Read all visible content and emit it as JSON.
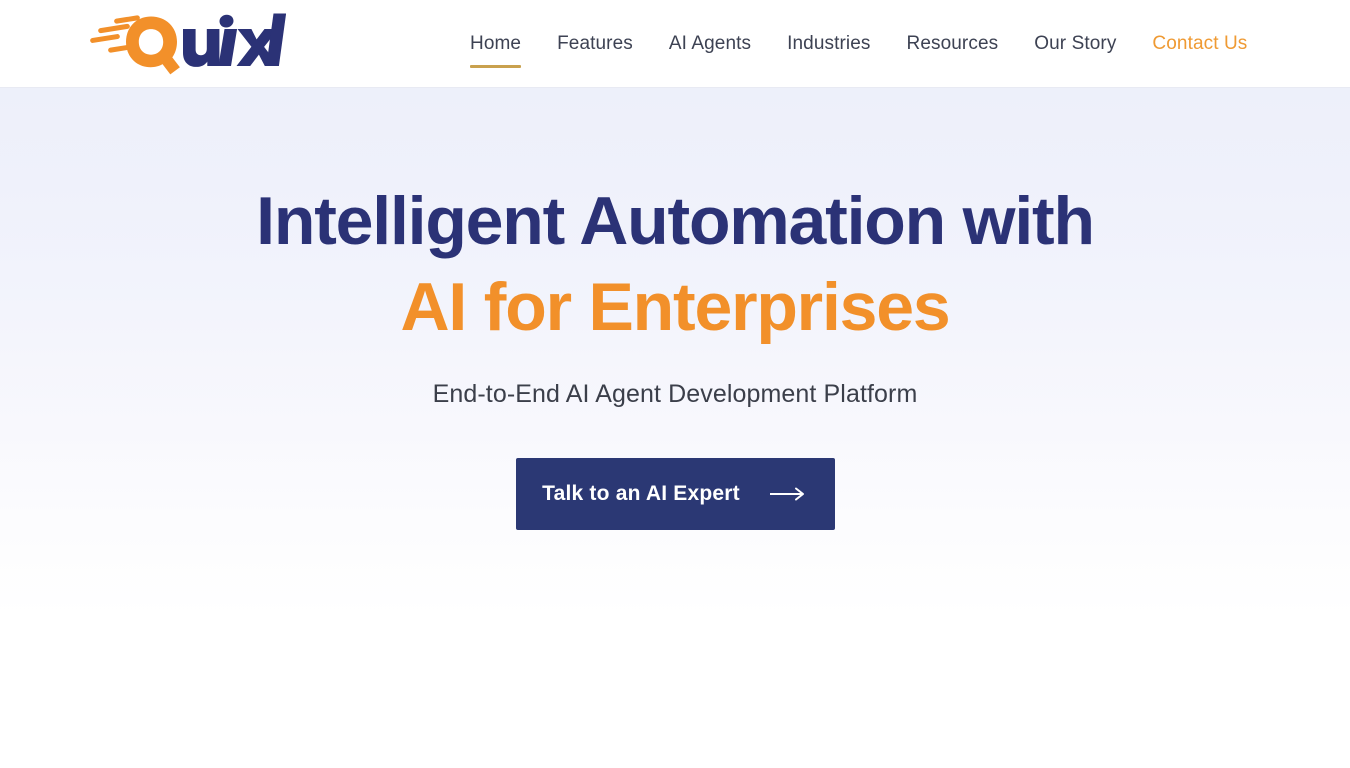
{
  "header": {
    "logo": {
      "name": "quixl-logo",
      "text": "Quixl",
      "mark_color": "#F2902A",
      "word_color": "#2B3276"
    },
    "nav": {
      "items": [
        {
          "label": "Home",
          "state": "active",
          "underline_color": "#C9A14E"
        },
        {
          "label": "Features",
          "state": "default",
          "underline_color": ""
        },
        {
          "label": "AI Agents",
          "state": "default",
          "underline_color": ""
        },
        {
          "label": "Industries",
          "state": "default",
          "underline_color": ""
        },
        {
          "label": "Resources",
          "state": "default",
          "underline_color": ""
        },
        {
          "label": "Our Story",
          "state": "default",
          "underline_color": ""
        },
        {
          "label": "Contact Us",
          "state": "accent",
          "underline_color": ""
        }
      ]
    }
  },
  "hero": {
    "title_line_1": "Intelligent Automation with",
    "title_line_2": "AI for Enterprises",
    "subtitle": "End-to-End AI Agent Development Platform",
    "cta": {
      "label": "Talk to an AI Expert",
      "icon": "arrow-right-icon",
      "background": "#2B3874",
      "text_color": "#FFFFFF"
    },
    "background_top": "#EDF0FA",
    "background_bottom": "#FFFFFF"
  },
  "colors": {
    "navy": "#2B3276",
    "orange": "#F2902A",
    "gold_underline": "#C9A14E",
    "nav_text": "#3D4253",
    "subtitle_text": "#3B3F4A"
  }
}
